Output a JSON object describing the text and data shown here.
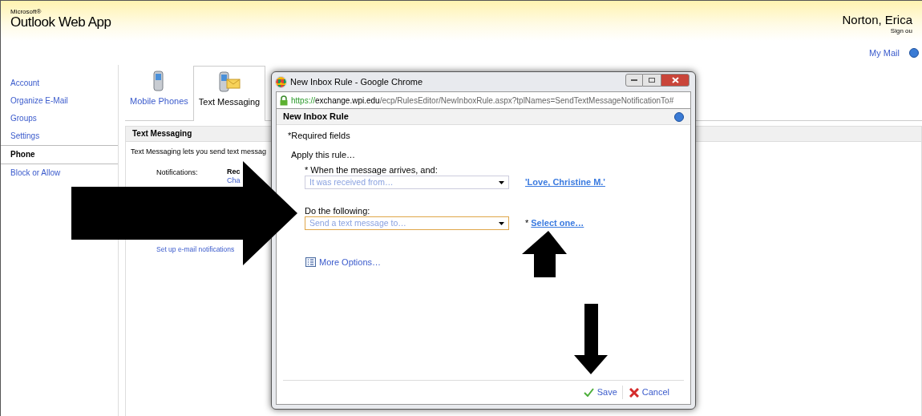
{
  "header": {
    "brand_small": "Microsoft®",
    "title": "Outlook Web App",
    "user": "Norton, Erica",
    "sign_out": "Sign ou",
    "my_mail": "My Mail"
  },
  "nav": [
    {
      "label": "Account",
      "selected": false
    },
    {
      "label": "Organize E-Mail",
      "selected": false
    },
    {
      "label": "Groups",
      "selected": false
    },
    {
      "label": "Settings",
      "selected": false
    },
    {
      "label": "Phone",
      "selected": true
    },
    {
      "label": "Block or Allow",
      "selected": false
    }
  ],
  "tabs": [
    {
      "label": "Mobile Phones",
      "kind": "phone",
      "selected": false
    },
    {
      "label": "Text Messaging",
      "kind": "message",
      "selected": true
    }
  ],
  "panel": {
    "title": "Text Messaging",
    "description": "Text Messaging lets you send text messag",
    "notifications_label": "Notifications:",
    "notifications_value": "Rec",
    "change_link": "Cha",
    "setup_link": "Set up e-mail notifications"
  },
  "dialog": {
    "window_title": "New Inbox Rule - Google Chrome",
    "url_scheme": "https://",
    "url_host": "exchange.wpi.edu",
    "url_path": "/ecp/RulesEditor/NewInboxRule.aspx?tplNames=SendTextMessageNotificationTo#",
    "header": "New Inbox Rule",
    "required_note": "*Required fields",
    "apply": "Apply this rule…",
    "rules": [
      {
        "label": "* When the message arrives, and:",
        "placeholder": "It was received from…",
        "focused": false,
        "link": "'Love, Christine M.'"
      },
      {
        "label": "Do the following:",
        "placeholder": "Send a text message to…",
        "focused": true,
        "required_mark": "*",
        "link": "Select one…"
      }
    ],
    "more_options": "More Options…",
    "buttons": [
      {
        "label": "Save",
        "kind": "save"
      },
      {
        "label": "Cancel",
        "kind": "cancel"
      }
    ]
  }
}
